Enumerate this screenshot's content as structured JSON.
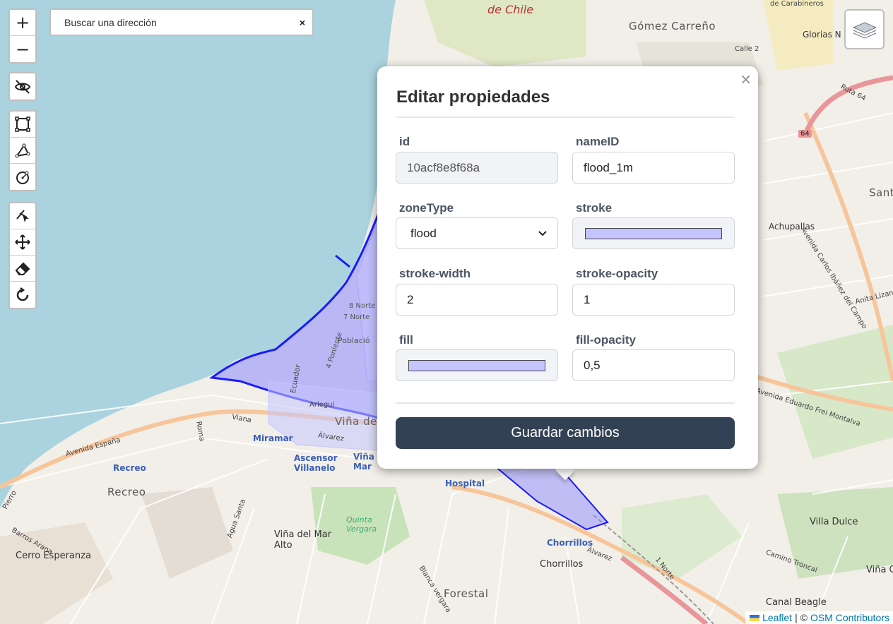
{
  "map": {
    "labels": {
      "de_chile": "de Chile",
      "gomez_carreno": "Gómez Carreño",
      "calle2": "Calle 2",
      "carabineros": "de Carabineros",
      "glorias": "Glorias N",
      "ruta64": "Ruta 64",
      "shield64": "64",
      "achupallas": "Achupallas",
      "avenida_carlos": "Avenida Carlos Ibáñez del Campo",
      "anita": "Anita Lizan",
      "santa": "Sant",
      "frei": "Avenida Eduardo Frei Montalva",
      "villa_dulce": "Villa Dulce",
      "camino_troncal": "Camino Troncal",
      "vina_o": "Viña O",
      "canal_beagle": "Canal Beagle",
      "chorrillos_blue": "Chorrillos",
      "chorrillos": "Chorrillos",
      "alvarez2": "Álvarez",
      "norte1": "1 Norte",
      "forestal": "Forestal",
      "blanca_vergara": "Blanca vergara",
      "hospital": "Hospital",
      "quinta_vergara": "Quinta Vergara",
      "vina_alto": "Viña del Mar Alto",
      "agua_santa": "Agua Santa",
      "ascensor": "Ascensor Villanelo",
      "vina_mar": "Viña Mar",
      "miramar": "Miramar",
      "alvarez": "Álvarez",
      "viana": "Viana",
      "avenida_espana": "Avenida España",
      "recreo_blue": "Recreo",
      "recreo": "Recreo",
      "barros": "Barros Arana",
      "cerro_esperanza": "Cerro Esperanza",
      "roma": "Roma",
      "vina_de": "Viña de",
      "arlegui": "Arlegui",
      "ecuador": "Ecuador",
      "norte8": "8 Norte",
      "norte7": "7 Norte",
      "poblacion": "Població",
      "poniente4": "4 Poniente",
      "pieiro": "Pierro"
    }
  },
  "toolbar": {
    "zoom_in": "+",
    "zoom_out": "−",
    "tools": [
      {
        "name": "hide-icon"
      },
      {
        "name": "draw-rectangle-icon"
      },
      {
        "name": "draw-polyline-icon"
      },
      {
        "name": "draw-circle-icon"
      },
      {
        "name": "cut-icon"
      },
      {
        "name": "move-icon"
      },
      {
        "name": "eraser-icon"
      },
      {
        "name": "rotate-icon"
      }
    ]
  },
  "search": {
    "placeholder": "Buscar una dirección",
    "close": "×"
  },
  "popup": {
    "close": "×",
    "title": "Editar propiedades",
    "fields": {
      "id": {
        "label": "id",
        "value": "10acf8e8f68a"
      },
      "nameID": {
        "label": "nameID",
        "value": "flood_1m"
      },
      "zoneType": {
        "label": "zoneType",
        "value": "flood"
      },
      "stroke": {
        "label": "stroke",
        "value": "#c4c4ff"
      },
      "stroke_width": {
        "label": "stroke-width",
        "value": "2"
      },
      "stroke_opacity": {
        "label": "stroke-opacity",
        "value": "1"
      },
      "fill": {
        "label": "fill",
        "value": "#c4c4ff"
      },
      "fill_opacity": {
        "label": "fill-opacity",
        "value": "0,5"
      }
    },
    "save_label": "Guardar cambios"
  },
  "attribution": {
    "leaflet": "Leaflet",
    "sep": "| ©",
    "osm": "OSM Contributors"
  },
  "colors": {
    "sea": "#aad3df",
    "land": "#f2efe9",
    "flood_stroke": "#1a1aff",
    "flood_fill": "#8080ff",
    "primary_button": "#334155"
  }
}
